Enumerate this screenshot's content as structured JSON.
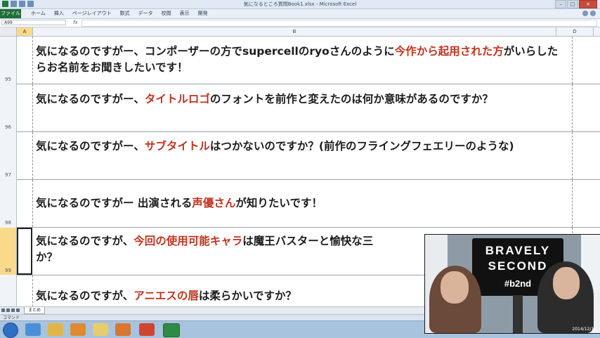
{
  "window": {
    "title": "気になるところ質問Book1.xlsx - Microsoft Excel",
    "controls": {
      "minimize": "–",
      "maximize": "□",
      "close": "×"
    }
  },
  "ribbon": {
    "file_tab": "ファイル",
    "tabs": [
      "ホーム",
      "挿入",
      "ページレイアウト",
      "数式",
      "データ",
      "校閲",
      "表示",
      "開発"
    ]
  },
  "formula_bar": {
    "name_box": "A99",
    "fx": "fx",
    "value": ""
  },
  "columns": {
    "a": "A",
    "b": "B",
    "d": "D"
  },
  "rows": [
    {
      "number": "95",
      "parts": [
        {
          "text": "気になるのですがー、コンポーザーの方でsupercellのryoさんのように",
          "red": false
        },
        {
          "text": "今作から起用された方",
          "red": true
        },
        {
          "text": "がいらしたらお名前をお聞きしたいです！",
          "red": false
        }
      ]
    },
    {
      "number": "96",
      "parts": [
        {
          "text": "気になるのですがー、",
          "red": false
        },
        {
          "text": "タイトルロゴ",
          "red": true
        },
        {
          "text": "のフォントを前作と変えたのは何か意味があるのですか？",
          "red": false
        }
      ]
    },
    {
      "number": "97",
      "parts": [
        {
          "text": "気になるのですがー、",
          "red": false
        },
        {
          "text": "サブタイトル",
          "red": true
        },
        {
          "text": "はつかないのですか？(前作のフライングフェエリーのような)",
          "red": false
        }
      ]
    },
    {
      "number": "98",
      "parts": [
        {
          "text": "気になるのですがー 出演される",
          "red": false
        },
        {
          "text": "声優さん",
          "red": true
        },
        {
          "text": "が知りたいです！",
          "red": false
        }
      ]
    },
    {
      "number": "99",
      "parts": [
        {
          "text": "気になるのですが、",
          "red": false
        },
        {
          "text": "今回の使用可能キャラ",
          "red": true
        },
        {
          "text": "は魔王バスターと愉快な三",
          "red": false
        },
        {
          "text": "か？",
          "red": false
        }
      ]
    },
    {
      "number": "",
      "parts": [
        {
          "text": "気になるのですが、",
          "red": false
        },
        {
          "text": "アニエスの唇",
          "red": true
        },
        {
          "text": "は柔らかいですか？",
          "red": false
        }
      ]
    }
  ],
  "sheet_tab": "まとめ",
  "status": "コマンド",
  "overlay": {
    "line1": "BRAVELY",
    "line2": "SECOND",
    "hashtag": "#b2nd",
    "date": "2014/12/11"
  },
  "colors": {
    "accent_red": "#c0331f",
    "excel_green": "#1f6f36"
  }
}
